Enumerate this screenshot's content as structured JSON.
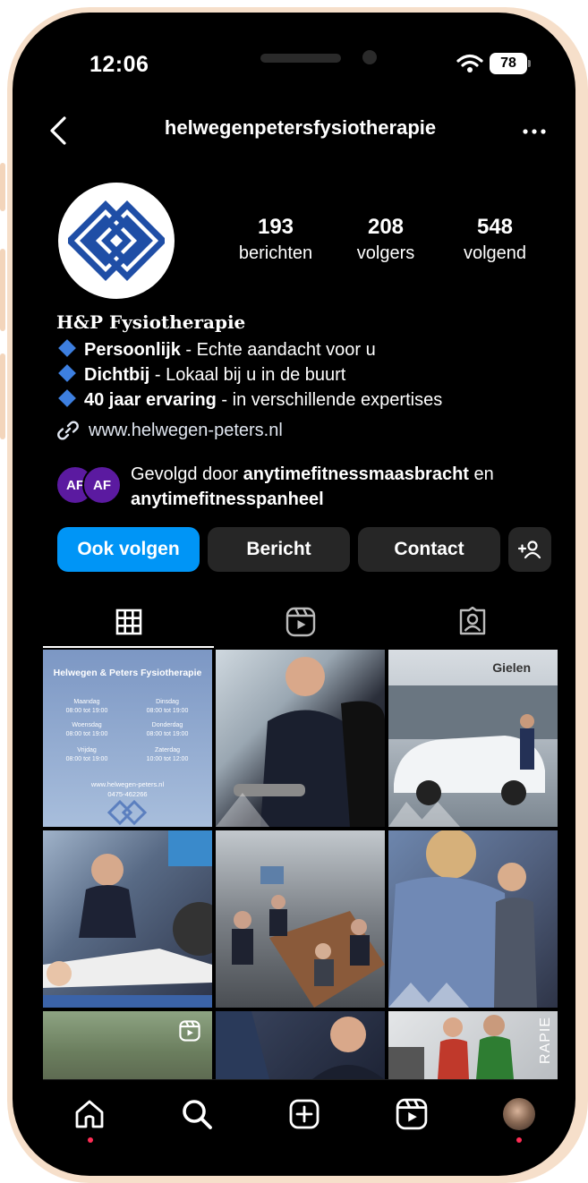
{
  "status_bar": {
    "time": "12:06",
    "battery": "78"
  },
  "header": {
    "username": "helwegenpetersfysiotherapie"
  },
  "stats": [
    {
      "value": "193",
      "label": "berichten"
    },
    {
      "value": "208",
      "label": "volgers"
    },
    {
      "value": "548",
      "label": "volgend"
    }
  ],
  "bio": {
    "name": "H&P Fysiotherapie",
    "lines": [
      {
        "bold": "Persoonlijk",
        "rest": " - Echte aandacht voor u"
      },
      {
        "bold": "Dichtbij",
        "rest": " - Lokaal bij u in de buurt"
      },
      {
        "bold": "40 jaar ervaring",
        "rest": " - in verschillende expertises"
      }
    ],
    "link": "www.helwegen-peters.nl"
  },
  "followed_by": {
    "prefix": "Gevolgd door ",
    "user1": "anytimefitnessmaasbracht",
    "conj": " en",
    "user2": "anytimefitnesspanheel",
    "avatar1": "AF",
    "avatar2": "AF"
  },
  "actions": {
    "follow": "Ook volgen",
    "message": "Bericht",
    "contact": "Contact",
    "add_person": "+8"
  },
  "post1": {
    "title": "Helwegen & Peters Fysiotherapie",
    "hours": [
      {
        "day": "Maandag",
        "time": "08:00 tot 19:00"
      },
      {
        "day": "Dinsdag",
        "time": "08:00 tot 19:00"
      },
      {
        "day": "Woensdag",
        "time": "08:00 tot 19:00"
      },
      {
        "day": "Donderdag",
        "time": "08:00 tot 19:00"
      },
      {
        "day": "Vrijdag",
        "time": "08:00 tot 19:00"
      },
      {
        "day": "Zaterdag",
        "time": "10:00 tot 12:00"
      }
    ],
    "website": "www.helwegen-peters.nl",
    "phone": "0475-462266"
  },
  "post3": {
    "sign": "Gielen"
  },
  "post9": {
    "side_text": "RAPIE"
  },
  "colors": {
    "accent": "#0095f6",
    "background": "#000000",
    "button": "#262626",
    "bullet": "#3d7fe0"
  }
}
